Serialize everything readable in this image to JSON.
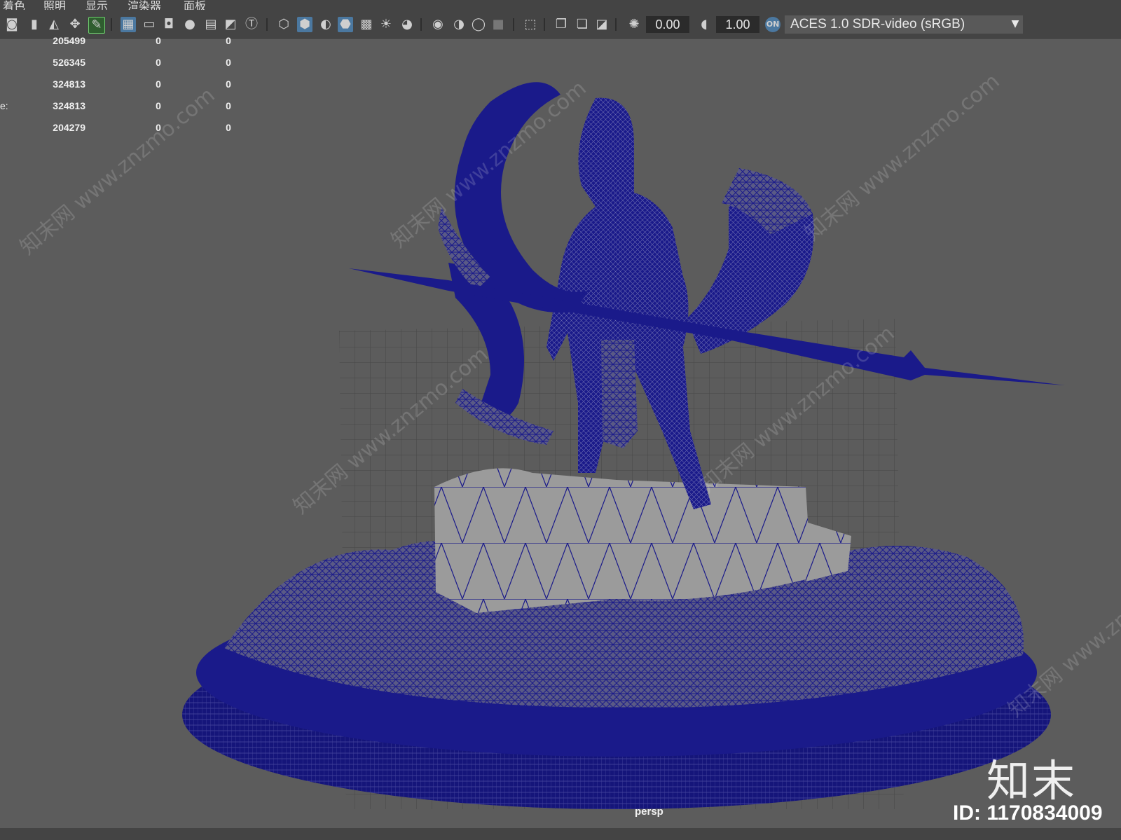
{
  "menu": {
    "items": [
      "着色",
      "照明",
      "显示",
      "渲染器",
      "面板"
    ]
  },
  "toolbar": {
    "exposure_value": "0.00",
    "gamma_value": "1.00",
    "color_space": "ACES 1.0 SDR-video (sRGB)",
    "icons": [
      "camera-icon",
      "bookmark-icon",
      "image-plane-icon",
      "2d-pan-icon",
      "grease-pencil-icon",
      "grid-icon",
      "film-gate-icon",
      "resolution-gate-icon",
      "gate-mask-icon",
      "field-chart-icon",
      "safe-action-icon",
      "safe-title-icon",
      "wireframe-icon",
      "smooth-shade-icon",
      "default-material-icon",
      "wireframe-on-shaded-icon",
      "xray-icon",
      "lights-icon",
      "shadows-icon",
      "ambient-occlusion-icon",
      "motion-blur-icon",
      "anti-aliasing-icon",
      "depth-of-field-icon",
      "isolate-select-icon",
      "xray-joints-icon",
      "xray-active-icon",
      "backface-icon",
      "exposure-icon",
      "gamma-icon",
      "color-management-icon"
    ],
    "accent_color": "#4b78a0"
  },
  "hud": {
    "rows": [
      {
        "label": "",
        "col1": "205499",
        "col2": "0",
        "col3": "0"
      },
      {
        "label": "",
        "col1": "526345",
        "col2": "0",
        "col3": "0"
      },
      {
        "label": "",
        "col1": "324813",
        "col2": "0",
        "col3": "0"
      },
      {
        "label": "e:",
        "col1": "324813",
        "col2": "0",
        "col3": "0"
      },
      {
        "label": "",
        "col1": "204279",
        "col2": "0",
        "col3": "0"
      }
    ]
  },
  "viewport": {
    "camera": "persp",
    "wire_color": "#1a1a8a",
    "background": "#5c5c5c"
  },
  "branding": {
    "logo_text": "知末",
    "id_text": "ID: 1170834009",
    "watermark": "知末网 www.znzmo.com"
  }
}
